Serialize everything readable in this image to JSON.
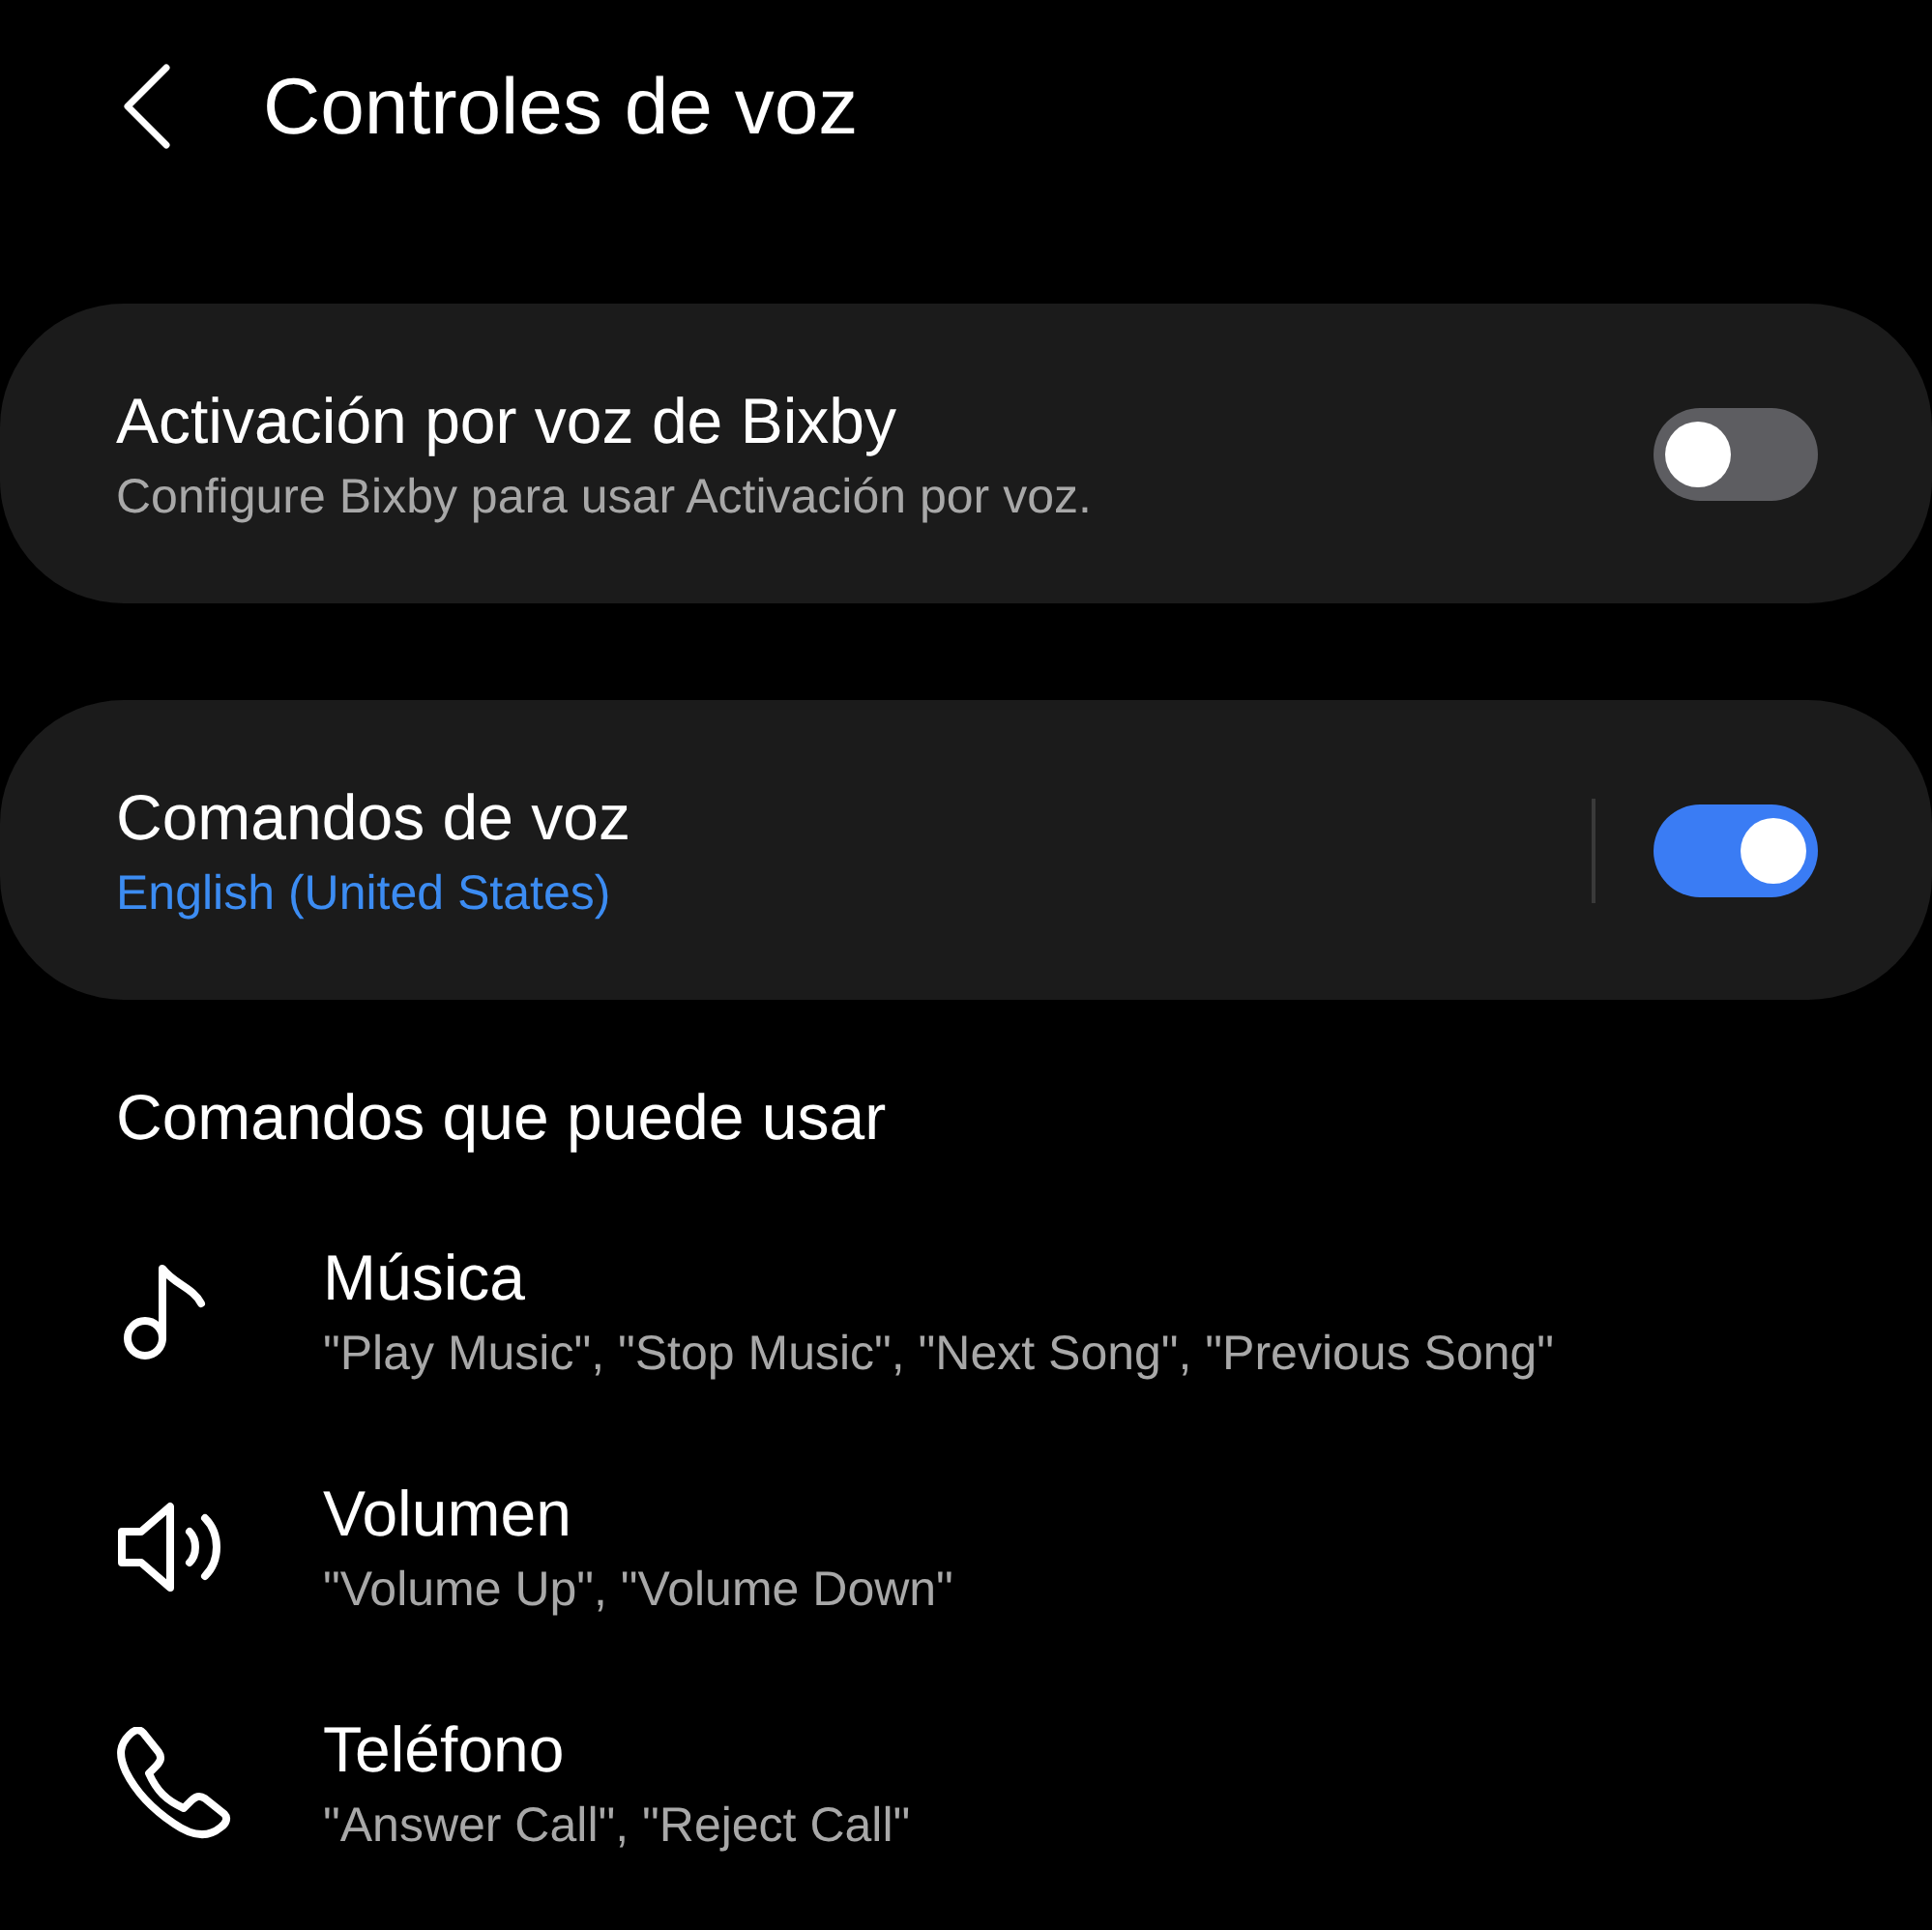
{
  "header": {
    "title": "Controles de voz"
  },
  "settings": [
    {
      "kind": "plain",
      "title": "Activación por voz de Bixby",
      "subtitle": "Configure Bixby para usar Activación por voz.",
      "on": false
    },
    {
      "kind": "link",
      "title": "Comandos de voz",
      "subtitle": "English (United States)",
      "on": true
    }
  ],
  "section": {
    "title": "Comandos que puede usar",
    "commands": [
      {
        "kind": "music",
        "title": "Música",
        "examples": "\"Play Music\", \"Stop Music\", \"Next Song\", \"Previous Song\""
      },
      {
        "kind": "volume",
        "title": "Volumen",
        "examples": "\"Volume Up\", \"Volume Down\""
      },
      {
        "kind": "phone",
        "title": "Teléfono",
        "examples": "\"Answer Call\", \"Reject Call\""
      }
    ]
  }
}
